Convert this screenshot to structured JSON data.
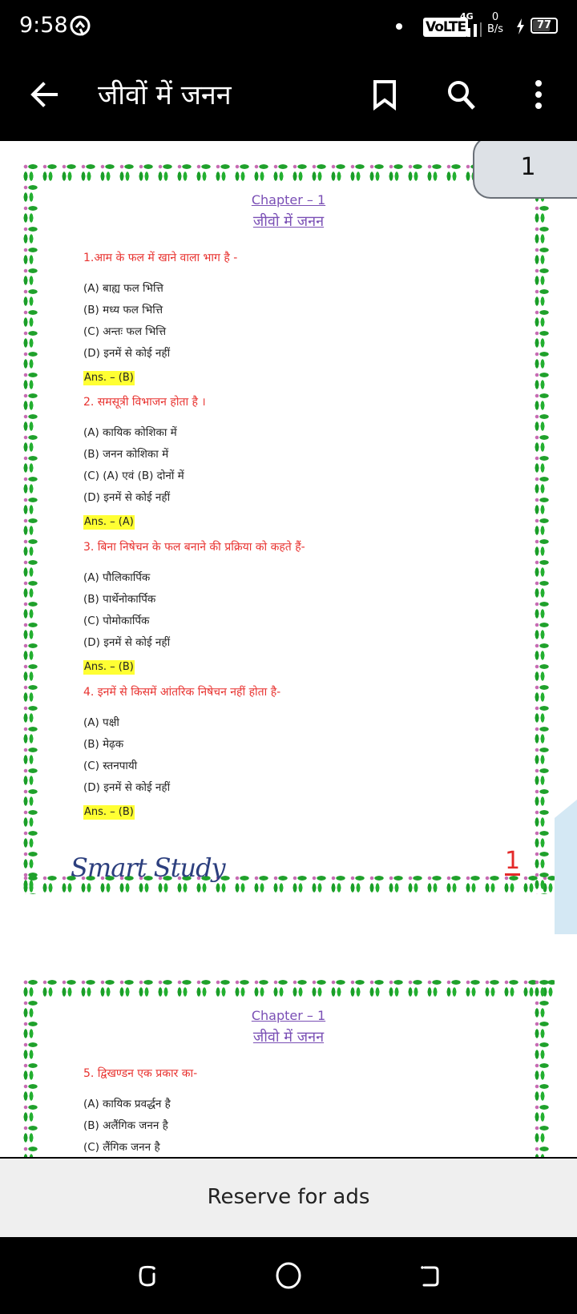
{
  "status_bar": {
    "time": "9:58",
    "network_type": "4G",
    "volte_label": "VoLTE",
    "data_speed_value": "0",
    "data_speed_unit": "B/s",
    "battery_level": "77",
    "battery_percent": 77
  },
  "app_bar": {
    "title": "जीवों में जनन",
    "icons": [
      "back-arrow-icon",
      "bookmark-icon",
      "search-icon",
      "more-vert-icon"
    ]
  },
  "viewer": {
    "page_indicator": "1",
    "pages": [
      {
        "chapter_number": "Chapter – 1",
        "chapter_title": "जीवो में जनन",
        "questions": [
          {
            "question": "1.आम के फल में खाने वाला भाग है -",
            "options": [
              "(A) बाह्य फल भित्ति",
              "(B) मध्य फल भित्ति",
              "(C) अन्तः फल भित्ति",
              "(D) इनमें से कोई नहीं"
            ],
            "answer": "Ans. – (B)"
          },
          {
            "question": "2. समसूत्री विभाजन होता है ।",
            "options": [
              "(A) कायिक कोशिका में",
              "(B) जनन कोशिका में",
              "(C) (A) एवं (B) दोनों में",
              "(D) इनमें से कोई नहीं"
            ],
            "answer": "Ans. – (A)"
          },
          {
            "question": "3. बिना निषेचन के फल बनाने की प्रक्रिया को कहते हैं-",
            "options": [
              "(A) पौलिकार्पिक",
              "(B) पार्थेनोकार्पिक",
              "(C) पोमोकार्पिक",
              "(D) इनमें से कोई नहीं"
            ],
            "answer": "Ans. – (B)"
          },
          {
            "question": "4. इनमें से किसमें आंतरिक निषेचन नहीं होता है-",
            "options": [
              "(A) पक्षी",
              "(B) मेढ़क",
              "(C) स्तनपायी",
              "(D) इनमें से कोई नहीं"
            ],
            "answer": "Ans. – (B)"
          }
        ],
        "brand": "Smart Study",
        "footer_page_number": "1"
      },
      {
        "chapter_number": "Chapter – 1",
        "chapter_title": "जीवो में जनन",
        "questions": [
          {
            "question": "5. द्विखण्डन एक प्रकार का-",
            "options": [
              "(A) कायिक प्रवर्द्धन है",
              "(B) अलैंगिक जनन है",
              "(C) लैंगिक जनन है"
            ]
          }
        ]
      }
    ]
  },
  "ad_bar": {
    "label": "Reserve for ads"
  },
  "nav_bar": {
    "buttons": [
      "recents",
      "home",
      "back"
    ]
  },
  "colors": {
    "question_red": "#e8322f",
    "chapter_purple": "#7a4fb5",
    "answer_highlight": "#ffff33",
    "brand_blue": "#2c3f7e",
    "border_green": "#1fa12b",
    "border_berry": "#c66bb3",
    "corner_shade": "#d4e8f4"
  }
}
